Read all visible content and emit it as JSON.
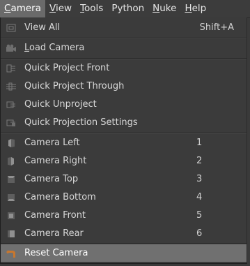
{
  "menubar": {
    "items": [
      {
        "accel": "C",
        "rest": "amera",
        "active": true
      },
      {
        "accel": "V",
        "rest": "iew",
        "active": false
      },
      {
        "accel": "T",
        "rest": "ools",
        "active": false
      },
      {
        "accel": "P",
        "rest": "ython",
        "active": false,
        "under_index": 1
      },
      {
        "accel": "N",
        "rest": "uke",
        "active": false
      },
      {
        "accel": "H",
        "rest": "elp",
        "active": false
      }
    ]
  },
  "camera_menu": {
    "view_all": {
      "label": "View All",
      "shortcut": "Shift+A",
      "icon": "view-all-icon"
    },
    "load_camera": {
      "accel": "L",
      "rest": "oad Camera",
      "icon": "camera-icon"
    },
    "quick_project_front": {
      "label": "Quick Project Front",
      "icon": "project-front-icon"
    },
    "quick_project_through": {
      "label": "Quick Project Through",
      "icon": "project-through-icon"
    },
    "quick_unproject": {
      "label": "Quick Unproject",
      "icon": "unproject-icon"
    },
    "quick_projection_settings": {
      "label": "Quick Projection Settings",
      "icon": "projection-settings-icon"
    },
    "camera_left": {
      "label": "Camera Left",
      "shortcut": "1",
      "icon": "cube-left-icon"
    },
    "camera_right": {
      "label": "Camera Right",
      "shortcut": "2",
      "icon": "cube-right-icon"
    },
    "camera_top": {
      "label": "Camera Top",
      "shortcut": "3",
      "icon": "cube-top-icon"
    },
    "camera_bottom": {
      "label": "Camera Bottom",
      "shortcut": "4",
      "icon": "cube-bottom-icon"
    },
    "camera_front": {
      "label": "Camera Front",
      "shortcut": "5",
      "icon": "cube-front-icon"
    },
    "camera_rear": {
      "label": "Camera Rear",
      "shortcut": "6",
      "icon": "cube-rear-icon"
    },
    "reset_camera": {
      "label": "Reset Camera",
      "icon": "reset-arrow-icon",
      "highlighted": true
    }
  },
  "colors": {
    "menu_bg": "#3b3b3b",
    "highlight": "#707070",
    "reset_icon": "#c8772e"
  }
}
